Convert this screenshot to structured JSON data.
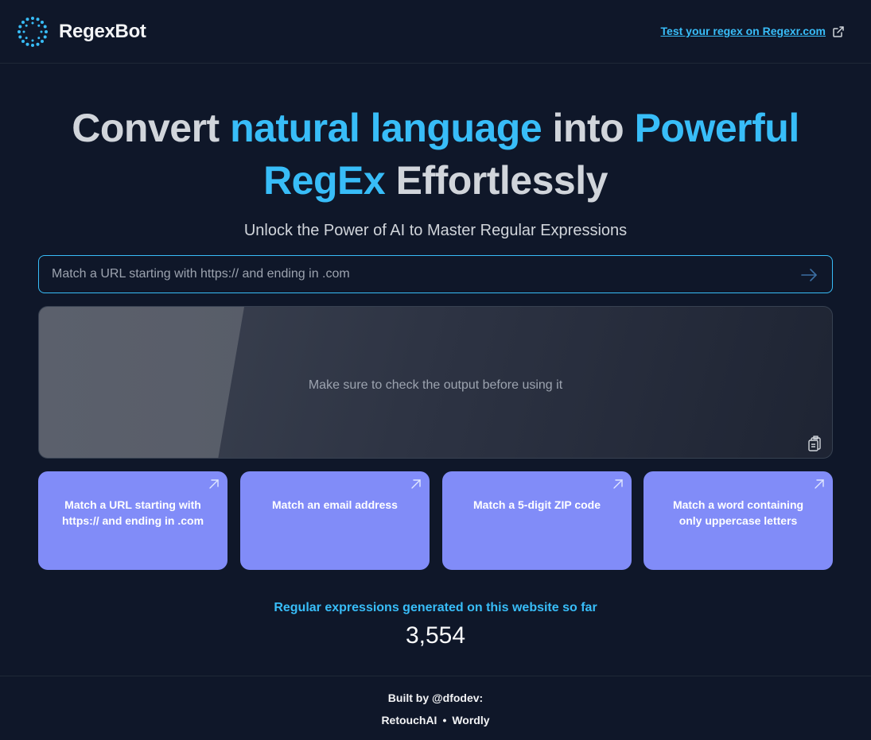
{
  "header": {
    "brand": "RegexBot",
    "external_link": "Test your regex on Regexr.com"
  },
  "hero": {
    "title_parts": [
      {
        "text": "Convert ",
        "highlight": false
      },
      {
        "text": "natural language",
        "highlight": true
      },
      {
        "text": " into ",
        "highlight": false
      },
      {
        "text": "Powerful",
        "highlight": true
      },
      {
        "text": " ",
        "highlight": false
      },
      {
        "text": "RegEx",
        "highlight": true
      },
      {
        "text": " Effortlessly",
        "highlight": false
      }
    ],
    "subtitle": "Unlock the Power of AI to Master Regular Expressions"
  },
  "prompt": {
    "placeholder": "Match a URL starting with https:// and ending in .com"
  },
  "output": {
    "message": "Make sure to check the output before using it"
  },
  "examples": [
    {
      "label": "Match a URL starting with https:// and ending in .com"
    },
    {
      "label": "Match an email address"
    },
    {
      "label": "Match a 5-digit ZIP code"
    },
    {
      "label": "Match a word containing only uppercase letters"
    }
  ],
  "stats": {
    "label": "Regular expressions generated on this website so far",
    "count": "3,554"
  },
  "footer": {
    "built_by": "Built by @dfodev:",
    "links": [
      "RetouchAI",
      "Wordly"
    ],
    "separator": "•"
  },
  "colors": {
    "background": "#0f1729",
    "accent": "#38bdf8",
    "card": "#818cf8"
  }
}
